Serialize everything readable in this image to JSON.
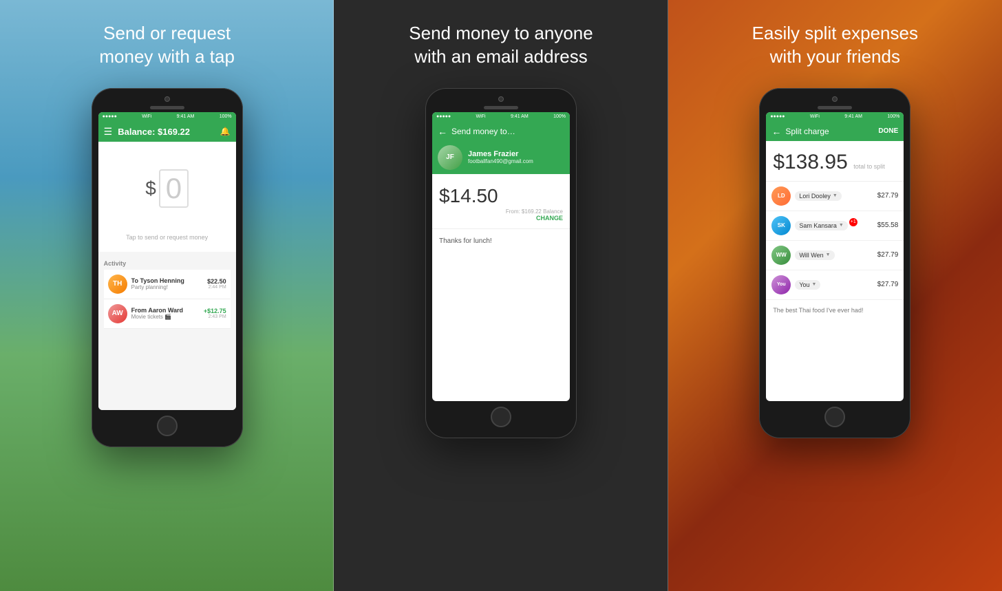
{
  "panel1": {
    "heading": "Send or request\nmoney with a tap",
    "phone": {
      "status": {
        "signal": "●●●●●",
        "wifi": "WiFi",
        "time": "9:41 AM",
        "battery": "100%"
      },
      "header": {
        "balance_label": "Balance: $169.22",
        "icon_menu": "☰",
        "icon_bell": "🔔"
      },
      "amount": {
        "dollar": "$",
        "zero": "0"
      },
      "tap_hint": "Tap to send or request money",
      "activity_label": "Activity",
      "transactions": [
        {
          "name": "To Tyson Henning",
          "note": "Party planning!",
          "amount": "$22.50",
          "time": "2:44 PM",
          "positive": false,
          "initials": "TH",
          "avatar_class": "avatar-tyson"
        },
        {
          "name": "From Aaron Ward",
          "note": "Movie tickets 🎬",
          "amount": "+$12.75",
          "time": "2:43 PM",
          "positive": true,
          "initials": "AW",
          "avatar_class": "avatar-aaron"
        }
      ]
    }
  },
  "panel2": {
    "heading": "Send money to anyone\nwith an email address",
    "phone": {
      "status": {
        "time": "9:41 AM",
        "battery": "100%"
      },
      "header": {
        "back": "←",
        "title": "Send money to…"
      },
      "recipient": {
        "name": "James Frazier",
        "email": "footballfan490@gmail.com",
        "initials": "JF",
        "avatar_class": "avatar-james"
      },
      "amount": "$14.50",
      "from_label": "From: $169.22 Balance",
      "change_label": "CHANGE",
      "note": "Thanks for lunch!"
    }
  },
  "panel3": {
    "heading": "Easily split expenses\nwith your friends",
    "phone": {
      "status": {
        "time": "9:41 AM",
        "battery": "100%"
      },
      "header": {
        "back": "←",
        "title": "Split charge",
        "done": "DONE"
      },
      "total": "$138.95",
      "total_label": "total to split",
      "persons": [
        {
          "name": "Lori Dooley",
          "amount": "$27.79",
          "initials": "LD",
          "avatar_class": "avatar-lori",
          "badge": null
        },
        {
          "name": "Sam Kansara",
          "amount": "$55.58",
          "initials": "SK",
          "avatar_class": "avatar-sam",
          "badge": "+1"
        },
        {
          "name": "Will Wen",
          "amount": "$27.79",
          "initials": "WW",
          "avatar_class": "avatar-will",
          "badge": null
        },
        {
          "name": "You",
          "amount": "$27.79",
          "initials": "You",
          "avatar_class": "avatar-you",
          "badge": null
        }
      ],
      "note": "The best Thai food I've ever had!"
    }
  }
}
